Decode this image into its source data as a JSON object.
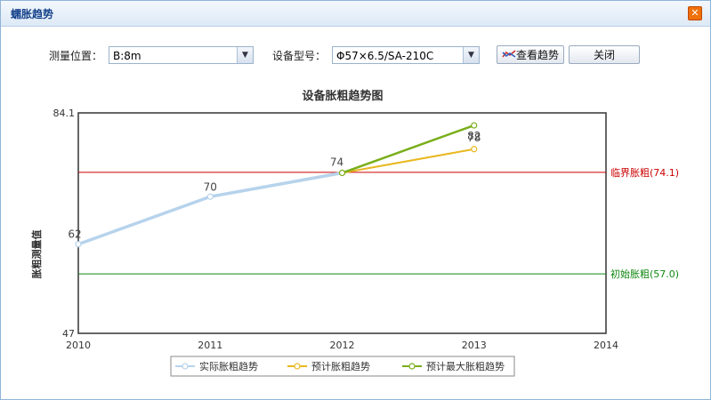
{
  "window": {
    "title": "蠕胀趋势",
    "close_glyph": "✕"
  },
  "toolbar": {
    "location_label": "测量位置：",
    "location_value": "B:8m",
    "model_label": "设备型号：",
    "model_value": "Φ57×6.5/SA-210C",
    "view_trend_label": "查看趋势",
    "close_label": "关闭"
  },
  "colors": {
    "actual": "#b7d3ec",
    "forecast": "#e8b820",
    "forecast_max": "#7aae1a",
    "critical": "#cc0000",
    "initial": "#118811"
  },
  "chart_data": {
    "type": "line",
    "title": "设备胀粗趋势图",
    "xlabel": "",
    "ylabel": "胀粗测量值",
    "x_ticks": [
      2010,
      2011,
      2012,
      2013,
      2014
    ],
    "xlim": [
      2010,
      2014
    ],
    "ylim": [
      47,
      84.1
    ],
    "y_tick_labels": [
      "84.1",
      "47"
    ],
    "series": [
      {
        "name": "实际胀粗趋势",
        "x": [
          2010,
          2011,
          2012
        ],
        "y": [
          62,
          70,
          74
        ],
        "labels": [
          "62",
          "70",
          "74"
        ]
      },
      {
        "name": "预计胀粗趋势",
        "x": [
          2012,
          2013
        ],
        "y": [
          74,
          78
        ],
        "labels": [
          "",
          "78"
        ]
      },
      {
        "name": "预计最大胀粗趋势",
        "x": [
          2012,
          2013
        ],
        "y": [
          74,
          82
        ],
        "labels": [
          "",
          "82"
        ]
      }
    ],
    "reference_lines": [
      {
        "label": "临界胀粗(74.1)",
        "value": 74.1
      },
      {
        "label": "初始胀粗(57.0)",
        "value": 57.0
      }
    ],
    "legend_position": "bottom"
  }
}
